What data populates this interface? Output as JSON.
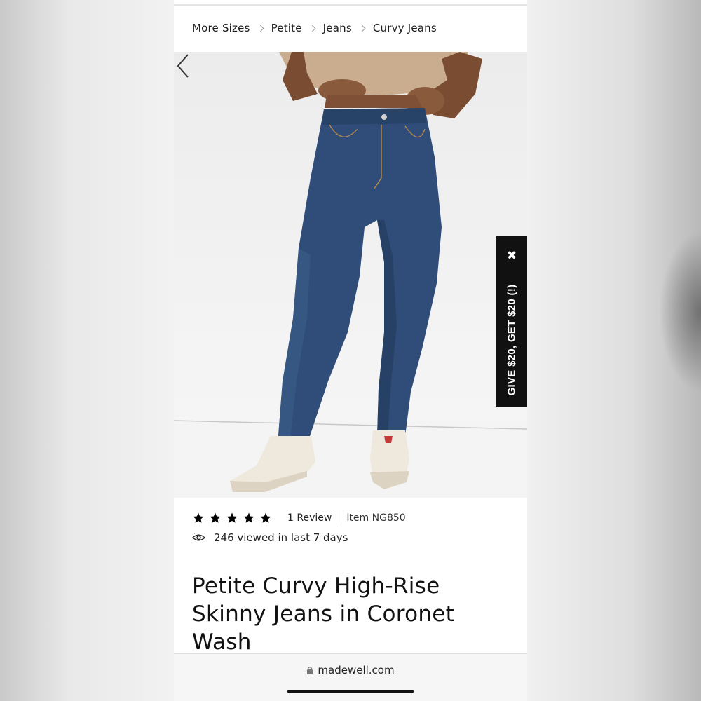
{
  "breadcrumb": {
    "items": [
      "More Sizes",
      "Petite",
      "Jeans",
      "Curvy Jeans"
    ]
  },
  "hero": {
    "image_alt": "Model wearing dark blue skinny jeans and white sneakers"
  },
  "referral": {
    "label": "GIVE $20, GET $20 (!)",
    "close_icon": "close-icon"
  },
  "rating": {
    "stars": 5,
    "star_icon": "star-icon",
    "review_label": "1 Review",
    "item_label": "Item NG850"
  },
  "views": {
    "icon": "eye-icon",
    "label": "246 viewed in last 7 days"
  },
  "product": {
    "title": "Petite Curvy High-Rise Skinny Jeans in Coronet Wash"
  },
  "browser": {
    "url": "madewell.com",
    "lock_icon": "lock-icon"
  },
  "colors": {
    "denim": "#2f4d78",
    "denim_dark": "#233b5e",
    "tab_bg": "#111111"
  }
}
